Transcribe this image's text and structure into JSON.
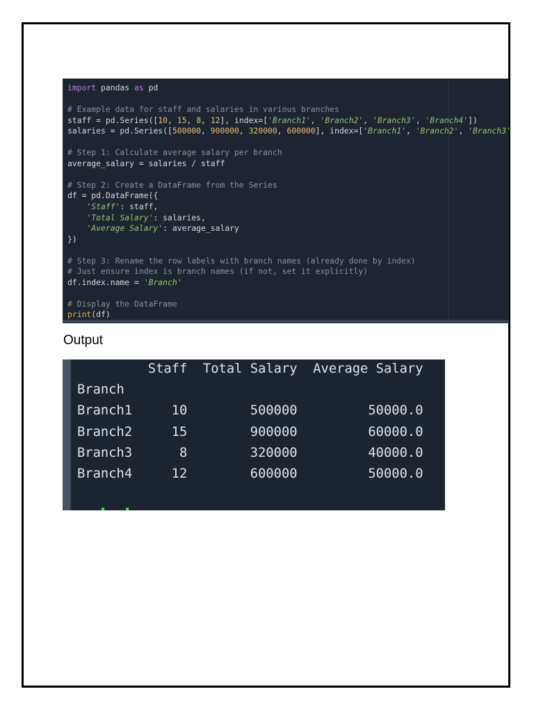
{
  "code_lines": [
    [
      [
        "kw",
        "import"
      ],
      [
        "t",
        " pandas "
      ],
      [
        "kw",
        "as"
      ],
      [
        "t",
        " pd"
      ]
    ],
    [],
    [
      [
        "com",
        "# Example data for staff and salaries in various branches"
      ]
    ],
    [
      [
        "t",
        "staff = pd.Series(["
      ],
      [
        "num",
        "10"
      ],
      [
        "t",
        ", "
      ],
      [
        "num",
        "15"
      ],
      [
        "t",
        ", "
      ],
      [
        "num",
        "8"
      ],
      [
        "t",
        ", "
      ],
      [
        "num",
        "12"
      ],
      [
        "t",
        "], index=["
      ],
      [
        "str",
        "'Branch1'"
      ],
      [
        "t",
        ", "
      ],
      [
        "str",
        "'Branch2'"
      ],
      [
        "t",
        ", "
      ],
      [
        "str",
        "'Branch3'"
      ],
      [
        "t",
        ", "
      ],
      [
        "str",
        "'Branch4'"
      ],
      [
        "t",
        "])"
      ]
    ],
    [
      [
        "t",
        "salaries = pd.Series(["
      ],
      [
        "num",
        "500000"
      ],
      [
        "t",
        ", "
      ],
      [
        "num",
        "900000"
      ],
      [
        "t",
        ", "
      ],
      [
        "num",
        "320000"
      ],
      [
        "t",
        ", "
      ],
      [
        "num",
        "600000"
      ],
      [
        "t",
        "], index=["
      ],
      [
        "str",
        "'Branch1'"
      ],
      [
        "t",
        ", "
      ],
      [
        "str",
        "'Branch2'"
      ],
      [
        "t",
        ", "
      ],
      [
        "str",
        "'Branch3'"
      ]
    ],
    [],
    [
      [
        "com",
        "# Step 1: Calculate average salary per branch"
      ]
    ],
    [
      [
        "t",
        "average_salary = salaries / staff"
      ]
    ],
    [],
    [
      [
        "com",
        "# Step 2: Create a DataFrame from the Series"
      ]
    ],
    [
      [
        "t",
        "df = pd.DataFrame({"
      ]
    ],
    [
      [
        "t",
        "    "
      ],
      [
        "str",
        "'Staff'"
      ],
      [
        "t",
        ": staff,"
      ]
    ],
    [
      [
        "t",
        "    "
      ],
      [
        "str",
        "'Total Salary'"
      ],
      [
        "t",
        ": salaries,"
      ]
    ],
    [
      [
        "t",
        "    "
      ],
      [
        "str",
        "'Average Salary'"
      ],
      [
        "t",
        ": average_salary"
      ]
    ],
    [
      [
        "t",
        "})"
      ]
    ],
    [],
    [
      [
        "com",
        "# Step 3: Rename the row labels with branch names (already done by index)"
      ]
    ],
    [
      [
        "com",
        "# Just ensure index is branch names (if not, set it explicitly)"
      ]
    ],
    [
      [
        "t",
        "df.index.name = "
      ],
      [
        "str",
        "'Branch'"
      ]
    ],
    [],
    [
      [
        "com",
        "# Display the DataFrame"
      ]
    ],
    [
      [
        "fn",
        "print"
      ],
      [
        "t",
        "(df)"
      ]
    ]
  ],
  "output_label": "Output",
  "output": {
    "index_name": "Branch",
    "columns": [
      "Staff",
      "Total Salary",
      "Average Salary"
    ],
    "rows": [
      [
        "Branch1",
        "10",
        "500000",
        "50000.0"
      ],
      [
        "Branch2",
        "15",
        "900000",
        "60000.0"
      ],
      [
        "Branch3",
        "8",
        "320000",
        "40000.0"
      ],
      [
        "Branch4",
        "12",
        "600000",
        "50000.0"
      ]
    ]
  }
}
